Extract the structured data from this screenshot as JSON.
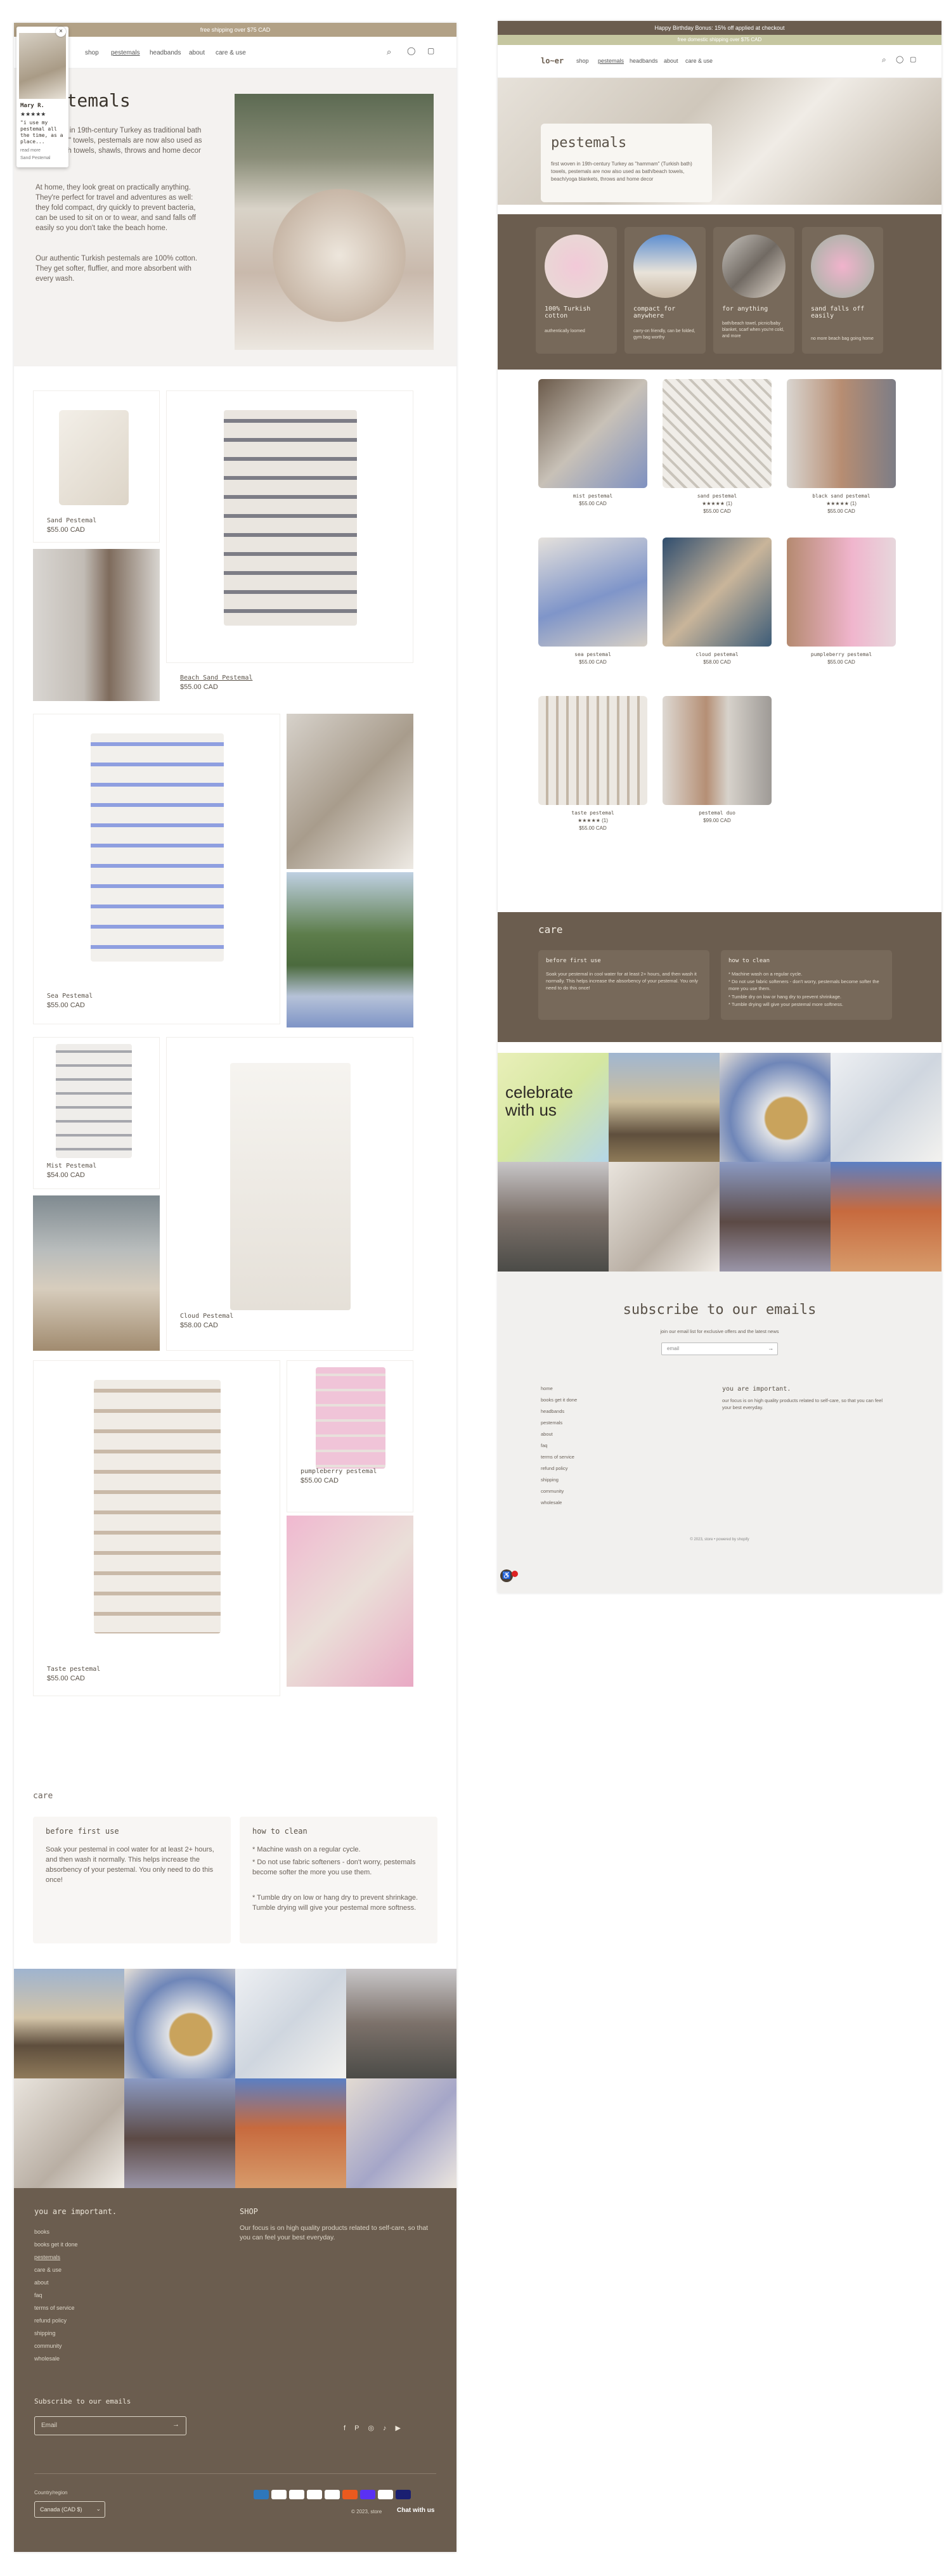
{
  "left": {
    "announcement": "free shipping over $75 CAD",
    "nav": [
      "shop",
      "pestemals",
      "headbands",
      "about",
      "care & use"
    ],
    "popup": {
      "name": "Mary R.",
      "stars": "★★★★★",
      "quote": "\"i use my pestemal all the time, as a place...",
      "more": "read more",
      "tag": "Sand Pestemal"
    },
    "hero": {
      "title": "pestemals",
      "p1": "originated in 19th-century Turkey as traditional bath \"hammam\" towels, pestemals are now also used as bath/beach towels, shawls, throws and home decor",
      "p2": "At home, they look great on practically anything. They're perfect for travel and adventures as well: they fold compact, dry quickly to prevent bacteria, can be used to sit on or to wear, and sand falls off easily so you don't take the beach home.",
      "p3": "Our authentic Turkish pestemals are 100% cotton. They get softer, fluffier, and more absorbent with every wash."
    },
    "products": [
      {
        "name": "Sand Pestemal",
        "price": "$55.00 CAD"
      },
      {
        "name": "Beach Sand Pestemal",
        "price": "$55.00 CAD"
      },
      {
        "name": "Sea Pestemal",
        "price": "$55.00 CAD"
      },
      {
        "name": "Mist Pestemal",
        "price": "$54.00 CAD"
      },
      {
        "name": "Cloud Pestemal",
        "price": "$58.00 CAD"
      },
      {
        "name": "pumpleberry pestemal",
        "price": "$55.00 CAD"
      },
      {
        "name": "Taste pestemal",
        "price": "$55.00 CAD"
      }
    ],
    "care": {
      "heading": "care",
      "box1_title": "before first use",
      "box1_text": "Soak your pestemal in cool water for at least 2+ hours, and then wash it normally. This helps increase the absorbency of your pestemal. You only need to do this once!",
      "box2_title": "how to clean",
      "box2_lines": [
        "* Machine wash on a regular cycle.",
        "* Do not use fabric softeners - don't worry, pestemals become softer the more you use them.",
        "* Tumble dry on low or hang dry to prevent shrinkage. Tumble drying will give your pestemal more softness."
      ]
    },
    "footer": {
      "col1_title": "you are important.",
      "links": [
        "books",
        "books get it done",
        "pestemals",
        "care & use",
        "about",
        "faq",
        "terms of service",
        "refund policy",
        "shipping",
        "community",
        "wholesale"
      ],
      "col2_title": "SHOP",
      "col2_text": "Our focus is on high quality products related to self-care, so that you can feel your best everyday.",
      "subscribe": "Subscribe to our emails",
      "email_placeholder": "Email",
      "country_label": "Country/region",
      "country": "Canada (CAD $)",
      "copyright": "© 2023, store",
      "chat": "Chat with us"
    }
  },
  "right": {
    "announcement": "Happy Birthday Bonus: 15% off applied at checkout",
    "announcement2": "free domestic shipping over $75 CAD",
    "logo": "lo~er",
    "nav": [
      "shop",
      "pestemals",
      "headbands",
      "about",
      "care & use"
    ],
    "hero_title": "pestemals",
    "hero_text": "first woven in 19th-century Turkey as \"hammam\" (Turkish bath) towels, pestemals are now also used as bath/beach towels, beach/yoga blankets, throws and home decor",
    "features": [
      {
        "title": "100% Turkish cotton",
        "text": "authentically loomed"
      },
      {
        "title": "compact for anywhere",
        "text": "carry-on friendly, can be folded, gym bag worthy"
      },
      {
        "title": "for anything",
        "text": "bath/beach towel, picnic/baby blanket, scarf when you're cold, and more"
      },
      {
        "title": "sand falls off easily",
        "text": "no more beach bag going home"
      }
    ],
    "products": [
      {
        "name": "mist pestemal",
        "stars": "",
        "price": "$55.00 CAD"
      },
      {
        "name": "sand pestemal",
        "stars": "★★★★★ (1)",
        "price": "$55.00 CAD"
      },
      {
        "name": "black sand pestemal",
        "stars": "★★★★★ (1)",
        "price": "$55.00 CAD"
      },
      {
        "name": "sea pestemal",
        "stars": "",
        "price": "$55.00 CAD"
      },
      {
        "name": "cloud pestemal",
        "stars": "",
        "price": "$58.00 CAD"
      },
      {
        "name": "pumpleberry pestemal",
        "stars": "",
        "price": "$55.00 CAD"
      },
      {
        "name": "taste pestemal",
        "stars": "★★★★★ (1)",
        "price": "$55.00 CAD"
      },
      {
        "name": "pestemal duo",
        "stars": "",
        "price": "$99.00 CAD"
      }
    ],
    "care": {
      "heading": "care",
      "box1_title": "before first use",
      "box1_text": "Soak your pestemal in cool water for at least 2+ hours, and then wash it normally. This helps increase the absorbency of your pestemal. You only need to do this once!",
      "box2_title": "how to clean",
      "box2_lines": [
        "* Machine wash on a regular cycle.",
        "* Do not use fabric softeners - don't worry, pestemals become softer the more you use them.",
        "* Tumble dry on low or hang dry to prevent shrinkage.",
        "* Tumble drying will give your pestemal more softness."
      ]
    },
    "celebrate": "celebrate with us",
    "subscribe_title": "subscribe to our emails",
    "subscribe_text": "join our email list for exclusive offers and the latest news",
    "email_placeholder": "email",
    "links": [
      "home",
      "books get it done",
      "headbands",
      "pestemals",
      "about",
      "faq",
      "terms of service",
      "refund policy",
      "shipping",
      "community",
      "wholesale"
    ],
    "col2_title": "you are important.",
    "col2_text": "our focus is on high quality products related to self-care, so that you can feel your best everyday.",
    "copyright": "© 2023, store • powered by shopify"
  },
  "colors": {
    "brown": "#6b5d4f",
    "tan": "#b2a186",
    "cream": "#f6f3ef",
    "sage": "#c5c6a0"
  }
}
